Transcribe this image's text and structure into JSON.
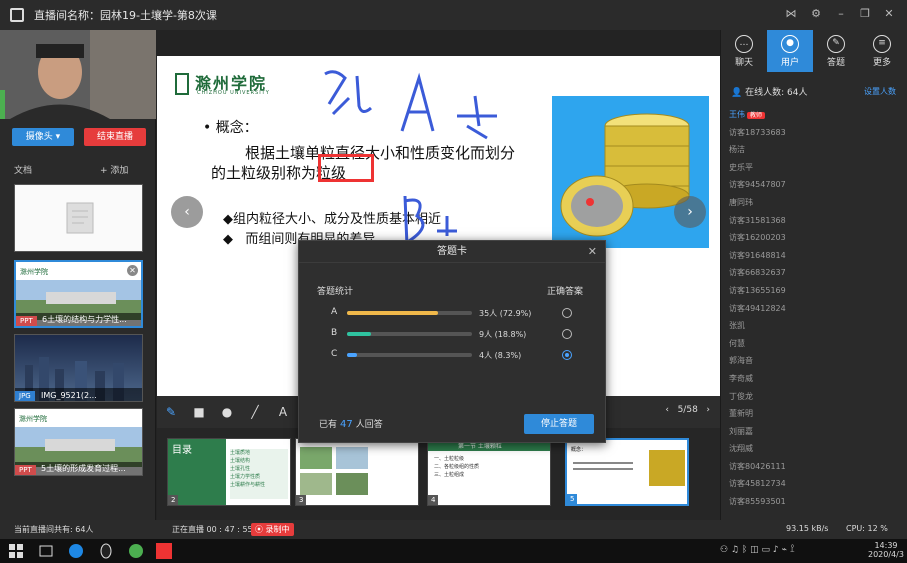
{
  "window": {
    "title": "直播间名称：园林19-土壤学-第8次课"
  },
  "left": {
    "camera_button": "摄像头 ▾",
    "end_live_button": "结束直播",
    "docs_label": "文档",
    "add_label": "+ 添加",
    "docs": [
      {
        "type": "",
        "name": ""
      },
      {
        "type": "PPT",
        "name": "6土壤的结构与力学性..."
      },
      {
        "type": "JPG",
        "name": "IMG_9521(2..."
      },
      {
        "type": "PPT",
        "name": "5土壤的形成发育过程..."
      }
    ]
  },
  "slide": {
    "logo_text": "滁州学院",
    "logo_sub": "CHIZHOU UNIVERSITY",
    "heading": "概念：",
    "line1": "根据土壤单粒直径大小和性质变化而划分",
    "line2_prefix": "的土粒级别称为",
    "highlight": "粒级",
    "bullet1": "组内粒径大小、成分及性质基本相近",
    "bullet2": "而组间则有明显的差异",
    "prev_arrow": "‹",
    "next_arrow": "›"
  },
  "toolbar": {
    "page_indicator": "5/58"
  },
  "filmstrip": {
    "items": [
      {
        "num": "2",
        "title": "目录",
        "lines": [
          "土壤质地",
          "土壤结构",
          "土壤孔性",
          "土壤力学性质",
          "土壤耕作与耕性"
        ]
      },
      {
        "num": "3",
        "title": "",
        "lines": []
      },
      {
        "num": "4",
        "title": "第一节 土壤颗粒",
        "lines": [
          "一、土粒粒级",
          "二、各粒级组的性质",
          "三、土粒组成"
        ]
      },
      {
        "num": "",
        "title": "",
        "lines": []
      },
      {
        "num": "5",
        "title": "概念：",
        "lines": []
      }
    ]
  },
  "right": {
    "tabs": [
      {
        "label": "聊天",
        "icon": "chat-icon"
      },
      {
        "label": "用户",
        "icon": "users-icon"
      },
      {
        "label": "答题",
        "icon": "pen-icon"
      },
      {
        "label": "更多",
        "icon": "menu-icon"
      }
    ],
    "active_tab": 1,
    "online_label": "在线人数: 64人",
    "set_count": "设置人数",
    "me_badge": "教师",
    "users": [
      "王伟",
      "访客18733683",
      "杨洁",
      "史乐平",
      "访客94547807",
      "唐同玮",
      "访客31581368",
      "访客16200203",
      "访客91648814",
      "访客66832637",
      "访客13655169",
      "访客49412824",
      "张凯",
      "何慧",
      "郭海音",
      "李奇威",
      "丁俊龙",
      "董新明",
      "刘丽嘉",
      "沈翔威",
      "访客80426111",
      "访客45812734",
      "访客85593501"
    ]
  },
  "status": {
    "total": "当前直播间共有: 64人",
    "live_time": "正在直播 00 : 47 : 55",
    "recording": "录制中",
    "bandwidth": "93.15 kB/s",
    "cpu": "CPU:  12 %"
  },
  "taskbar": {
    "time": "14:39",
    "date": "2020/4/3"
  },
  "dialog": {
    "title": "答题卡",
    "stats_label": "答题统计",
    "correct_label": "正确答案",
    "options": [
      {
        "label": "A",
        "count": "35人 (72.9%)",
        "fraction": 0.729,
        "color": "#f0b84a",
        "correct": false
      },
      {
        "label": "B",
        "count": "9人 (18.8%)",
        "fraction": 0.188,
        "color": "#2fc3a0",
        "correct": false
      },
      {
        "label": "C",
        "count": "4人 (8.3%)",
        "fraction": 0.083,
        "color": "#4aa3ff",
        "correct": true
      }
    ],
    "answered_prefix": "已有",
    "answered_count": "47",
    "answered_suffix": "人回答",
    "stop_button": "停止答题"
  }
}
